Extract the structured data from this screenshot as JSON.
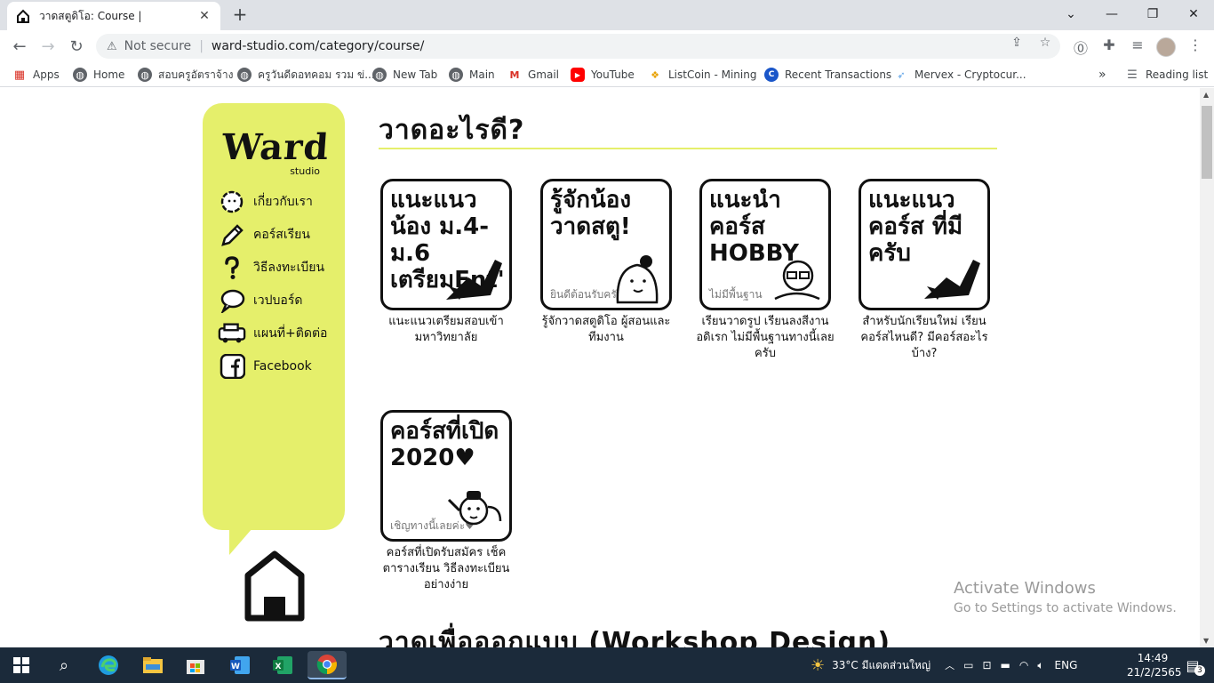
{
  "browser": {
    "tab_title": "วาดสตูดิโอ: Course |",
    "tab_close": "✕",
    "new_tab": "+",
    "security_label": "Not secure",
    "url": "ward-studio.com/category/course/",
    "bookmarks": [
      {
        "label": "Apps",
        "icon": "apps-grid-icon"
      },
      {
        "label": "Home",
        "icon": "globe-icon"
      },
      {
        "label": "สอบครูอัตราจ้าง",
        "icon": "globe-icon"
      },
      {
        "label": "ครูวันดีดอทคอม รวม ข่...",
        "icon": "globe-icon"
      },
      {
        "label": "New Tab",
        "icon": "globe-icon"
      },
      {
        "label": "Main",
        "icon": "globe-icon"
      },
      {
        "label": "Gmail",
        "icon": "gmail-icon"
      },
      {
        "label": "YouTube",
        "icon": "youtube-icon"
      },
      {
        "label": "ListCoin - Mining",
        "icon": "listcoin-icon"
      },
      {
        "label": "Recent Transactions",
        "icon": "c-icon"
      },
      {
        "label": "Mervex - Cryptocur...",
        "icon": "mervex-icon"
      }
    ],
    "bookmarks_overflow": "»",
    "reading_list": "Reading list"
  },
  "site": {
    "logo_text": "Ward",
    "logo_sub": "studio",
    "menu": [
      {
        "label": "เกี่ยวกับเรา",
        "icon": "flower-icon"
      },
      {
        "label": "คอร์สเรียน",
        "icon": "pencil-icon"
      },
      {
        "label": "วิธีลงทะเบียน",
        "icon": "question-icon"
      },
      {
        "label": "เวปบอร์ด",
        "icon": "speech-bubble-icon"
      },
      {
        "label": "แผนที่+ติดต่อ",
        "icon": "car-icon"
      },
      {
        "label": "Facebook",
        "icon": "facebook-icon"
      }
    ],
    "heading1": "วาดอะไรดี?",
    "heading2": "วาดเพื่อออกแบบ (Workshop Design)",
    "cards": [
      {
        "art": "แนะแนวน้อง ม.4-ม.6 เตรียมEnt'",
        "art_small": "",
        "caption": "แนะแนวเตรียมสอบเข้ามหาวิทยาลัย"
      },
      {
        "art": "รู้จักน้อง วาดสตู!",
        "art_small": "ยินดีต้อนรับครับ!",
        "caption": "รู้จักวาดสตูดิโอ ผู้สอนและทีมงาน"
      },
      {
        "art": "แนะนำ คอร์ส HOBBY",
        "art_small": "ไม่มีพื้นฐาน",
        "caption": "เรียนวาดรูป เรียนลงสีงานอดิเรก ไม่มีพื้นฐานทางนี้เลยครับ"
      },
      {
        "art": "แนะแนว คอร์ส ที่มี ครับ",
        "art_small": "",
        "caption": "สำหรับนักเรียนใหม่ เรียนคอร์สไหนดี? มีคอร์สอะไรบ้าง?"
      },
      {
        "art": "คอร์สที่เปิด 2020♥",
        "art_small": "เชิญทางนี้เลยค่ะ♥",
        "caption": "คอร์สที่เปิดรับสมัคร เช็คตารางเรียน วิธีลงทะเบียนอย่างง่าย"
      }
    ]
  },
  "watermark": {
    "line1": "Activate Windows",
    "line2": "Go to Settings to activate Windows."
  },
  "taskbar": {
    "weather": "33°C  มีแดดส่วนใหญ่",
    "lang": "ENG",
    "time": "14:49",
    "date": "21/2/2565",
    "notifications": "3"
  },
  "colors": {
    "accent_yellow": "#e5ef6b",
    "taskbar": "#1b2a3a"
  }
}
